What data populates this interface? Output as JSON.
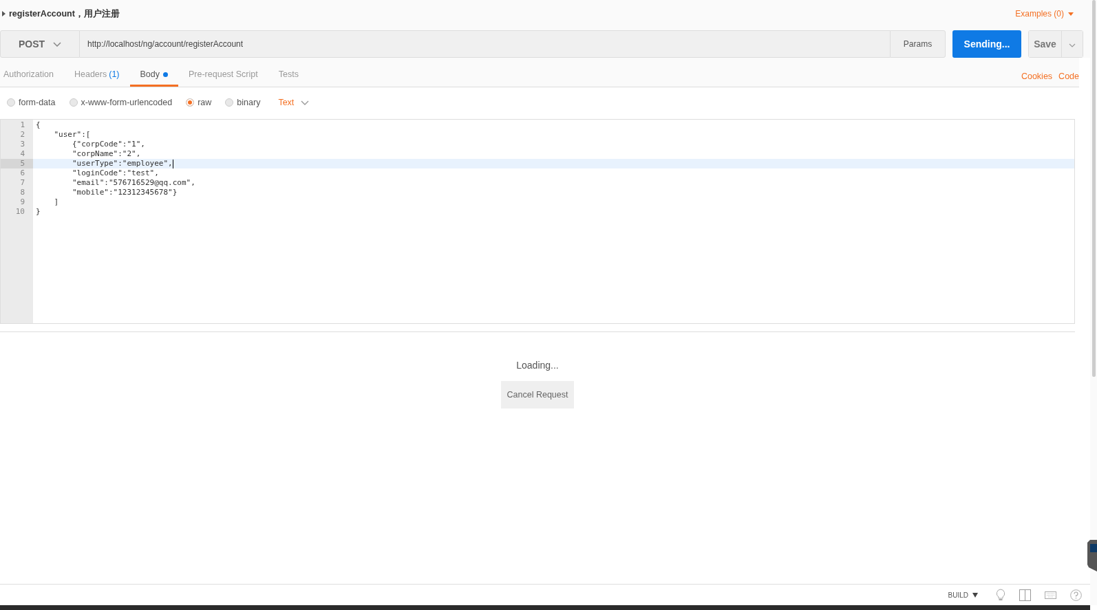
{
  "request": {
    "title": "registerAccount，用户注册",
    "examples": "Examples (0)"
  },
  "url_bar": {
    "method": "POST",
    "url": "http://localhost/ng/account/registerAccount",
    "params": "Params",
    "send": "Sending...",
    "save": "Save"
  },
  "tabs": [
    {
      "label": "Authorization",
      "selected": false
    },
    {
      "label": "Headers",
      "count": "(1)",
      "selected": false
    },
    {
      "label": "Body",
      "dot": true,
      "selected": true
    },
    {
      "label": "Pre-request Script",
      "selected": false
    },
    {
      "label": "Tests",
      "selected": false
    }
  ],
  "links": [
    "Cookies",
    "Code"
  ],
  "body_modes": [
    {
      "label": "form-data",
      "selected": false
    },
    {
      "label": "x-www-form-urlencoded",
      "selected": false
    },
    {
      "label": "raw",
      "selected": true
    },
    {
      "label": "binary",
      "selected": false
    }
  ],
  "format": "Text",
  "editor": {
    "lines": [
      {
        "number": "1",
        "text": "{",
        "active": false
      },
      {
        "number": "2",
        "text": "    \"user\":[",
        "active": false
      },
      {
        "number": "3",
        "text": "        {\"corpCode\":\"1\",",
        "active": false
      },
      {
        "number": "4",
        "text": "        \"corpName\":\"2\",",
        "active": false
      },
      {
        "number": "5",
        "text": "        \"userType\":\"employee\",",
        "active": true
      },
      {
        "number": "6",
        "text": "        \"loginCode\":\"test\",",
        "active": false
      },
      {
        "number": "7",
        "text": "        \"email\":\"576716529@qq.com\",",
        "active": false
      },
      {
        "number": "8",
        "text": "        \"mobile\":\"12312345678\"}",
        "active": false
      },
      {
        "number": "9",
        "text": "    ]",
        "active": false
      },
      {
        "number": "10",
        "text": "}",
        "active": false
      }
    ]
  },
  "response": {
    "status": "Loading...",
    "cancel": "Cancel Request"
  },
  "status_bar": {
    "build": "BUILD"
  }
}
